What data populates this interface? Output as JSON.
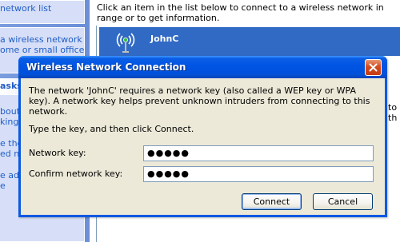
{
  "left_pane": {
    "top_link": "network list",
    "tasks_links": [
      "a wireless network",
      "ome or small office"
    ],
    "tasks_header": "asks",
    "related_links": [
      "bout",
      "king",
      "e the",
      "ed ne",
      "e adv",
      "e"
    ]
  },
  "main": {
    "instruction": "Click an item in the list below to connect to a wireless network in range or to get information.",
    "network_name": "JohnC",
    "partial_text": "to th"
  },
  "dialog": {
    "title": "Wireless Network Connection",
    "message": "The network 'JohnC' requires a network key (also called a WEP key or WPA key). A network key helps prevent unknown intruders from connecting to this network.",
    "prompt": "Type the key, and then click Connect.",
    "network_key_label": "Network key:",
    "network_key_value": "●●●●●",
    "confirm_key_label": "Confirm network key:",
    "confirm_key_value": "●●●●●",
    "connect_label": "Connect",
    "cancel_label": "Cancel"
  },
  "colors": {
    "titlebar": "#0054e3",
    "close_button": "#d44a1f",
    "selection": "#316ac5",
    "dialog_face": "#ece9d8",
    "task_pane": "#7a9cde"
  }
}
